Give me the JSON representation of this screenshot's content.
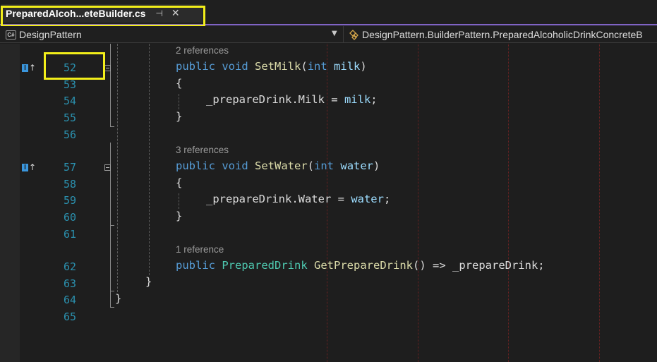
{
  "tab": {
    "title": "PreparedAlcoh...eteBuilder.cs",
    "pin_glyph": "⊣",
    "close_glyph": "✕",
    "active": true
  },
  "navbar": {
    "project": "DesignPattern",
    "project_icon": "csharp-project-icon",
    "project_icon_text": "C#",
    "dropdown_glyph": "▼",
    "type_icon": "class-icon",
    "type_path": "DesignPattern.BuilderPattern.PreparedAlcoholicDrinkConcreteB"
  },
  "editor": {
    "line_numbers": [
      "52",
      "53",
      "54",
      "55",
      "56",
      "57",
      "58",
      "59",
      "60",
      "61",
      "62",
      "63",
      "64",
      "65"
    ],
    "references": [
      "2 references",
      "3 references",
      "1 reference"
    ],
    "code": {
      "l52": {
        "kw1": "public",
        "kw2": "void",
        "fn": "SetMilk",
        "p1": "(",
        "type": "int",
        "param": "milk",
        "p2": ")"
      },
      "l53": "{",
      "l54": {
        "member": "_prepareDrink.Milk = ",
        "param": "milk",
        "end": ";"
      },
      "l55": "}",
      "l57": {
        "kw1": "public",
        "kw2": "void",
        "fn": "SetWater",
        "p1": "(",
        "type": "int",
        "param": "water",
        "p2": ")"
      },
      "l58": "{",
      "l59": {
        "member": "_prepareDrink.Water = ",
        "param": "water",
        "end": ";"
      },
      "l60": "}",
      "l62": {
        "kw1": "public",
        "type": "PreparedDrink",
        "fn": "GetPrepareDrink",
        "rest": "() => _prepareDrink;"
      },
      "l63": "}",
      "l64": "}"
    },
    "impl_icon_letter": "I",
    "impl_arrow": "↑"
  },
  "colors": {
    "highlight": "#f2ee1a",
    "keyword": "#569cd6",
    "method": "#dcdcaa",
    "parameter": "#9cdcfe",
    "type": "#4ec9b0",
    "line_number": "#2b91af",
    "tab_accent": "#7f63c4"
  }
}
